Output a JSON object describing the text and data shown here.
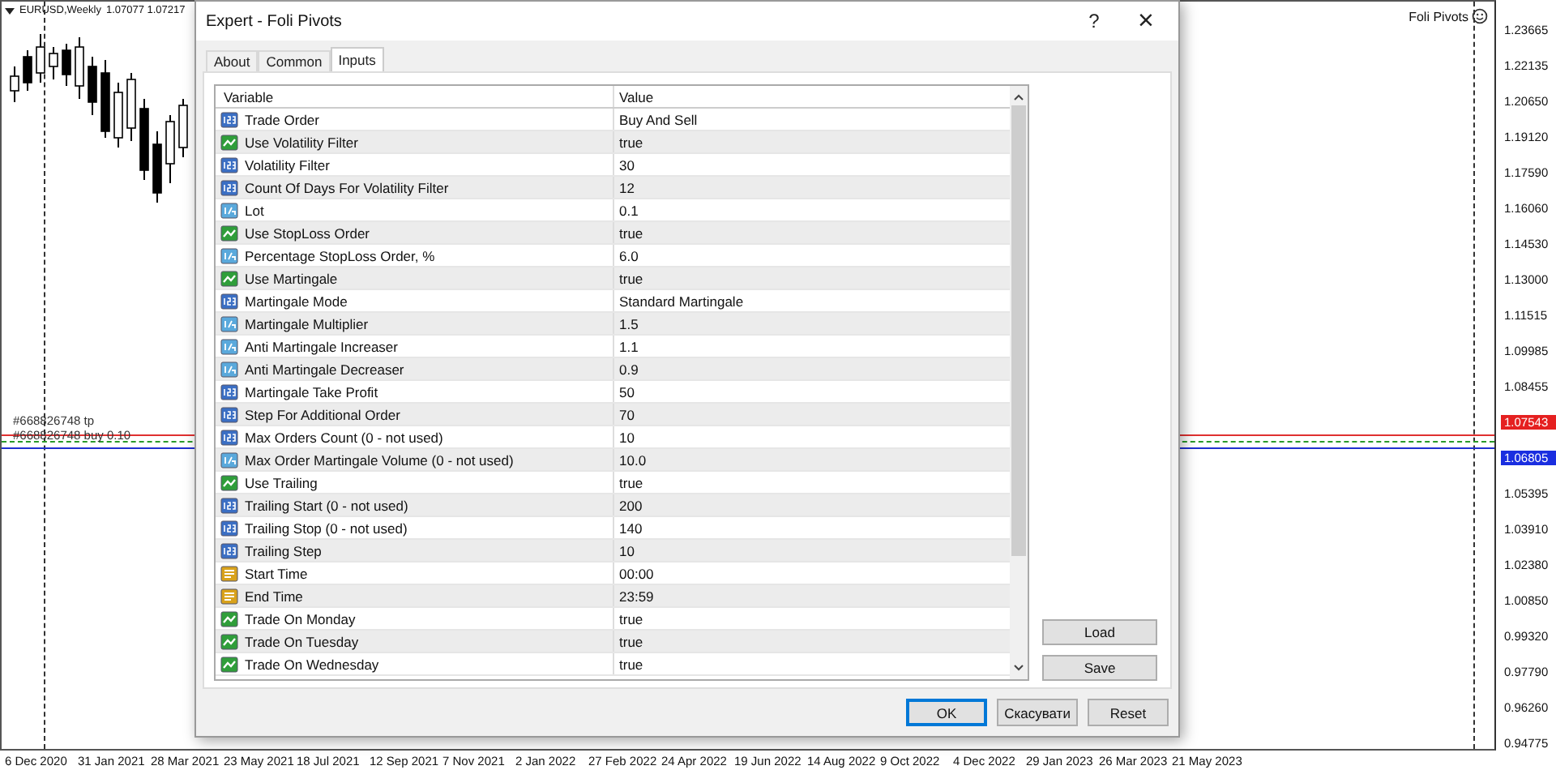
{
  "chart": {
    "symbol": "EURUSD,Weekly",
    "quote": "1.07077 1.07217",
    "indicator": "Foli Pivots",
    "order_labels": [
      "#668826748 tp",
      "#668826748 buy 0.10"
    ],
    "lines": [
      {
        "color": "#e03030"
      },
      {
        "color": "#2a9a2a"
      },
      {
        "color": "#2030d0"
      }
    ],
    "price_tags": [
      {
        "text": "1.07543",
        "color": "#e52020"
      },
      {
        "text": "1.06805",
        "color": "#1a2ee0"
      }
    ],
    "price_axis": [
      "1.23665",
      "1.22135",
      "1.20650",
      "1.19120",
      "1.17590",
      "1.16060",
      "1.14530",
      "1.13000",
      "1.11515",
      "1.09985",
      "1.08455",
      "1.05395",
      "1.03910",
      "1.02380",
      "1.00850",
      "0.99320",
      "0.97790",
      "0.96260",
      "0.94775"
    ],
    "time_axis": [
      "6 Dec 2020",
      "31 Jan 2021",
      "28 Mar 2021",
      "23 May 2021",
      "18 Jul 2021",
      "12 Sep 2021",
      "7 Nov 2021",
      "2 Jan 2022",
      "27 Feb 2022",
      "24 Apr 2022",
      "19 Jun 2022",
      "14 Aug 2022",
      "9 Oct 2022",
      "4 Dec 2022",
      "29 Jan 2023",
      "26 Mar 2023",
      "21 May 2023"
    ]
  },
  "dialog": {
    "title": "Expert - Foli Pivots",
    "help": "?",
    "close": "×",
    "tabs": [
      {
        "label": "About",
        "selected": false
      },
      {
        "label": "Common",
        "selected": false
      },
      {
        "label": "Inputs",
        "selected": true
      }
    ],
    "table": {
      "columns": [
        "Variable",
        "Value"
      ],
      "rows": [
        {
          "kind": "int",
          "variable": "Trade Order",
          "value": "Buy And Sell"
        },
        {
          "kind": "bool",
          "variable": "Use Volatility Filter",
          "value": "true"
        },
        {
          "kind": "int",
          "variable": "Volatility Filter",
          "value": "30"
        },
        {
          "kind": "int",
          "variable": "Count Of Days For Volatility Filter",
          "value": "12"
        },
        {
          "kind": "double",
          "variable": "Lot",
          "value": "0.1"
        },
        {
          "kind": "bool",
          "variable": "Use StopLoss Order",
          "value": "true"
        },
        {
          "kind": "double",
          "variable": "Percentage StopLoss Order, %",
          "value": "6.0"
        },
        {
          "kind": "bool",
          "variable": "Use Martingale",
          "value": "true"
        },
        {
          "kind": "int",
          "variable": "Martingale Mode",
          "value": "Standard Martingale"
        },
        {
          "kind": "double",
          "variable": "Martingale Multiplier",
          "value": "1.5"
        },
        {
          "kind": "double",
          "variable": "Anti Martingale Increaser",
          "value": "1.1"
        },
        {
          "kind": "double",
          "variable": "Anti Martingale Decreaser",
          "value": "0.9"
        },
        {
          "kind": "int",
          "variable": "Martingale Take Profit",
          "value": "50"
        },
        {
          "kind": "int",
          "variable": "Step For Additional Order",
          "value": "70"
        },
        {
          "kind": "int",
          "variable": "Max Orders Count (0 - not used)",
          "value": "10"
        },
        {
          "kind": "double",
          "variable": "Max Order Martingale Volume (0 - not used)",
          "value": "10.0"
        },
        {
          "kind": "bool",
          "variable": "Use Trailing",
          "value": "true"
        },
        {
          "kind": "int",
          "variable": "Trailing Start (0 - not used)",
          "value": "200"
        },
        {
          "kind": "int",
          "variable": "Trailing Stop (0 - not used)",
          "value": "140"
        },
        {
          "kind": "int",
          "variable": "Trailing Step",
          "value": "10"
        },
        {
          "kind": "string",
          "variable": "Start Time",
          "value": "00:00"
        },
        {
          "kind": "string",
          "variable": "End Time",
          "value": "23:59"
        },
        {
          "kind": "bool",
          "variable": "Trade On Monday",
          "value": "true"
        },
        {
          "kind": "bool",
          "variable": "Trade On Tuesday",
          "value": "true"
        },
        {
          "kind": "bool",
          "variable": "Trade On Wednesday",
          "value": "true"
        }
      ]
    },
    "side_buttons": [
      "Load",
      "Save"
    ],
    "buttons": [
      {
        "label": "OK",
        "default": true
      },
      {
        "label": "Скасувати",
        "default": false
      },
      {
        "label": "Reset",
        "default": false
      }
    ]
  }
}
